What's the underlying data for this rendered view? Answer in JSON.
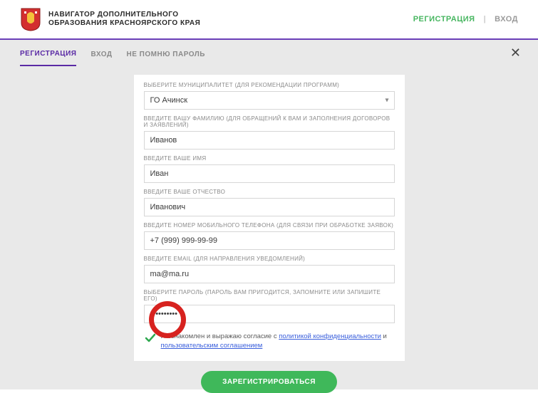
{
  "header": {
    "brand_line1": "НАВИГАТОР ДОПОЛНИТЕЛЬНОГО",
    "brand_line2": "ОБРАЗОВАНИЯ КРАСНОЯРСКОГО КРАЯ",
    "registration": "РЕГИСТРАЦИЯ",
    "login": "ВХОД"
  },
  "tabs": {
    "registration": "РЕГИСТРАЦИЯ",
    "login": "ВХОД",
    "forgot": "НЕ ПОМНЮ ПАРОЛЬ"
  },
  "form": {
    "municipality_label": "ВЫБЕРИТЕ МУНИЦИПАЛИТЕТ (ДЛЯ РЕКОМЕНДАЦИИ ПРОГРАММ)",
    "municipality_value": "ГО Ачинск",
    "lastname_label": "ВВЕДИТЕ ВАШУ ФАМИЛИЮ (ДЛЯ ОБРАЩЕНИЙ К ВАМ И ЗАПОЛНЕНИЯ ДОГОВОРОВ И ЗАЯВЛЕНИЙ)",
    "lastname_value": "Иванов",
    "firstname_label": "ВВЕДИТЕ ВАШЕ ИМЯ",
    "firstname_value": "Иван",
    "patronymic_label": "ВВЕДИТЕ ВАШЕ ОТЧЕСТВО",
    "patronymic_value": "Иванович",
    "phone_label": "ВВЕДИТЕ НОМЕР МОБИЛЬНОГО ТЕЛЕФОНА (ДЛЯ СВЯЗИ ПРИ ОБРАБОТКЕ ЗАЯВОК)",
    "phone_value": "+7 (999) 999-99-99",
    "email_label": "ВВЕДИТЕ EMAIL (ДЛЯ НАПРАВЛЕНИЯ УВЕДОМЛЕНИЙ)",
    "email_value": "ma@ma.ru",
    "password_label": "ВЫБЕРИТЕ ПАРОЛЬ (ПАРОЛЬ ВАМ ПРИГОДИТСЯ, ЗАПОМНИТЕ ИЛИ ЗАПИШИТЕ ЕГО)",
    "password_value": "••••••••••",
    "consent_prefix": "Я ознакомлен и выражаю согласие с ",
    "consent_link1": "политикой конфиденциальности",
    "consent_and": " и ",
    "consent_link2": "пользовательским соглашением",
    "submit": "ЗАРЕГИСТРИРОВАТЬСЯ"
  },
  "close_glyph": "✕"
}
